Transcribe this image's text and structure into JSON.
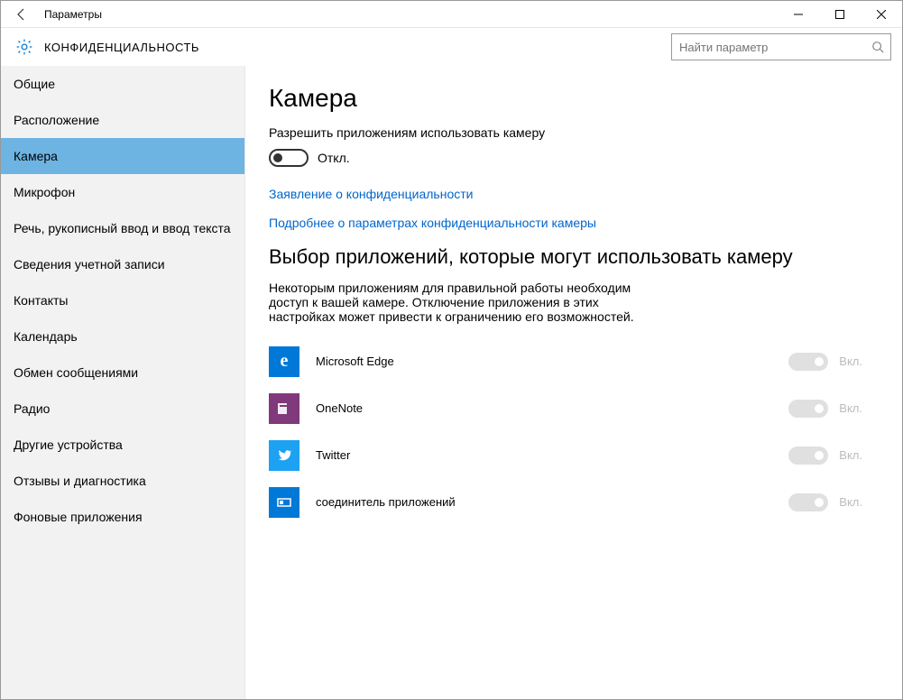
{
  "window": {
    "title": "Параметры"
  },
  "header": {
    "section": "КОНФИДЕНЦИАЛЬНОСТЬ",
    "search_placeholder": "Найти параметр"
  },
  "sidebar": {
    "items": [
      {
        "label": "Общие"
      },
      {
        "label": "Расположение"
      },
      {
        "label": "Камера",
        "active": true
      },
      {
        "label": "Микрофон"
      },
      {
        "label": "Речь, рукописный ввод и ввод текста"
      },
      {
        "label": "Сведения учетной записи"
      },
      {
        "label": "Контакты"
      },
      {
        "label": "Календарь"
      },
      {
        "label": "Обмен сообщениями"
      },
      {
        "label": "Радио"
      },
      {
        "label": "Другие устройства"
      },
      {
        "label": "Отзывы и диагностика"
      },
      {
        "label": "Фоновые приложения"
      }
    ]
  },
  "main": {
    "title": "Камера",
    "allow_label": "Разрешить приложениям использовать камеру",
    "toggle_state": "Откл.",
    "links": {
      "privacy_statement": "Заявление о конфиденциальности",
      "learn_more": "Подробнее о параметрах конфиденциальности камеры"
    },
    "apps_heading": "Выбор приложений, которые могут использовать камеру",
    "apps_description": "Некоторым приложениям для правильной работы необходим доступ к вашей камере. Отключение приложения в этих настройках может привести к ограничению его возможностей.",
    "apps": [
      {
        "name": "Microsoft Edge",
        "state": "Вкл.",
        "icon": "edge"
      },
      {
        "name": "OneNote",
        "state": "Вкл.",
        "icon": "onenote"
      },
      {
        "name": "Twitter",
        "state": "Вкл.",
        "icon": "twitter"
      },
      {
        "name": "соединитель приложений",
        "state": "Вкл.",
        "icon": "connector"
      }
    ]
  }
}
